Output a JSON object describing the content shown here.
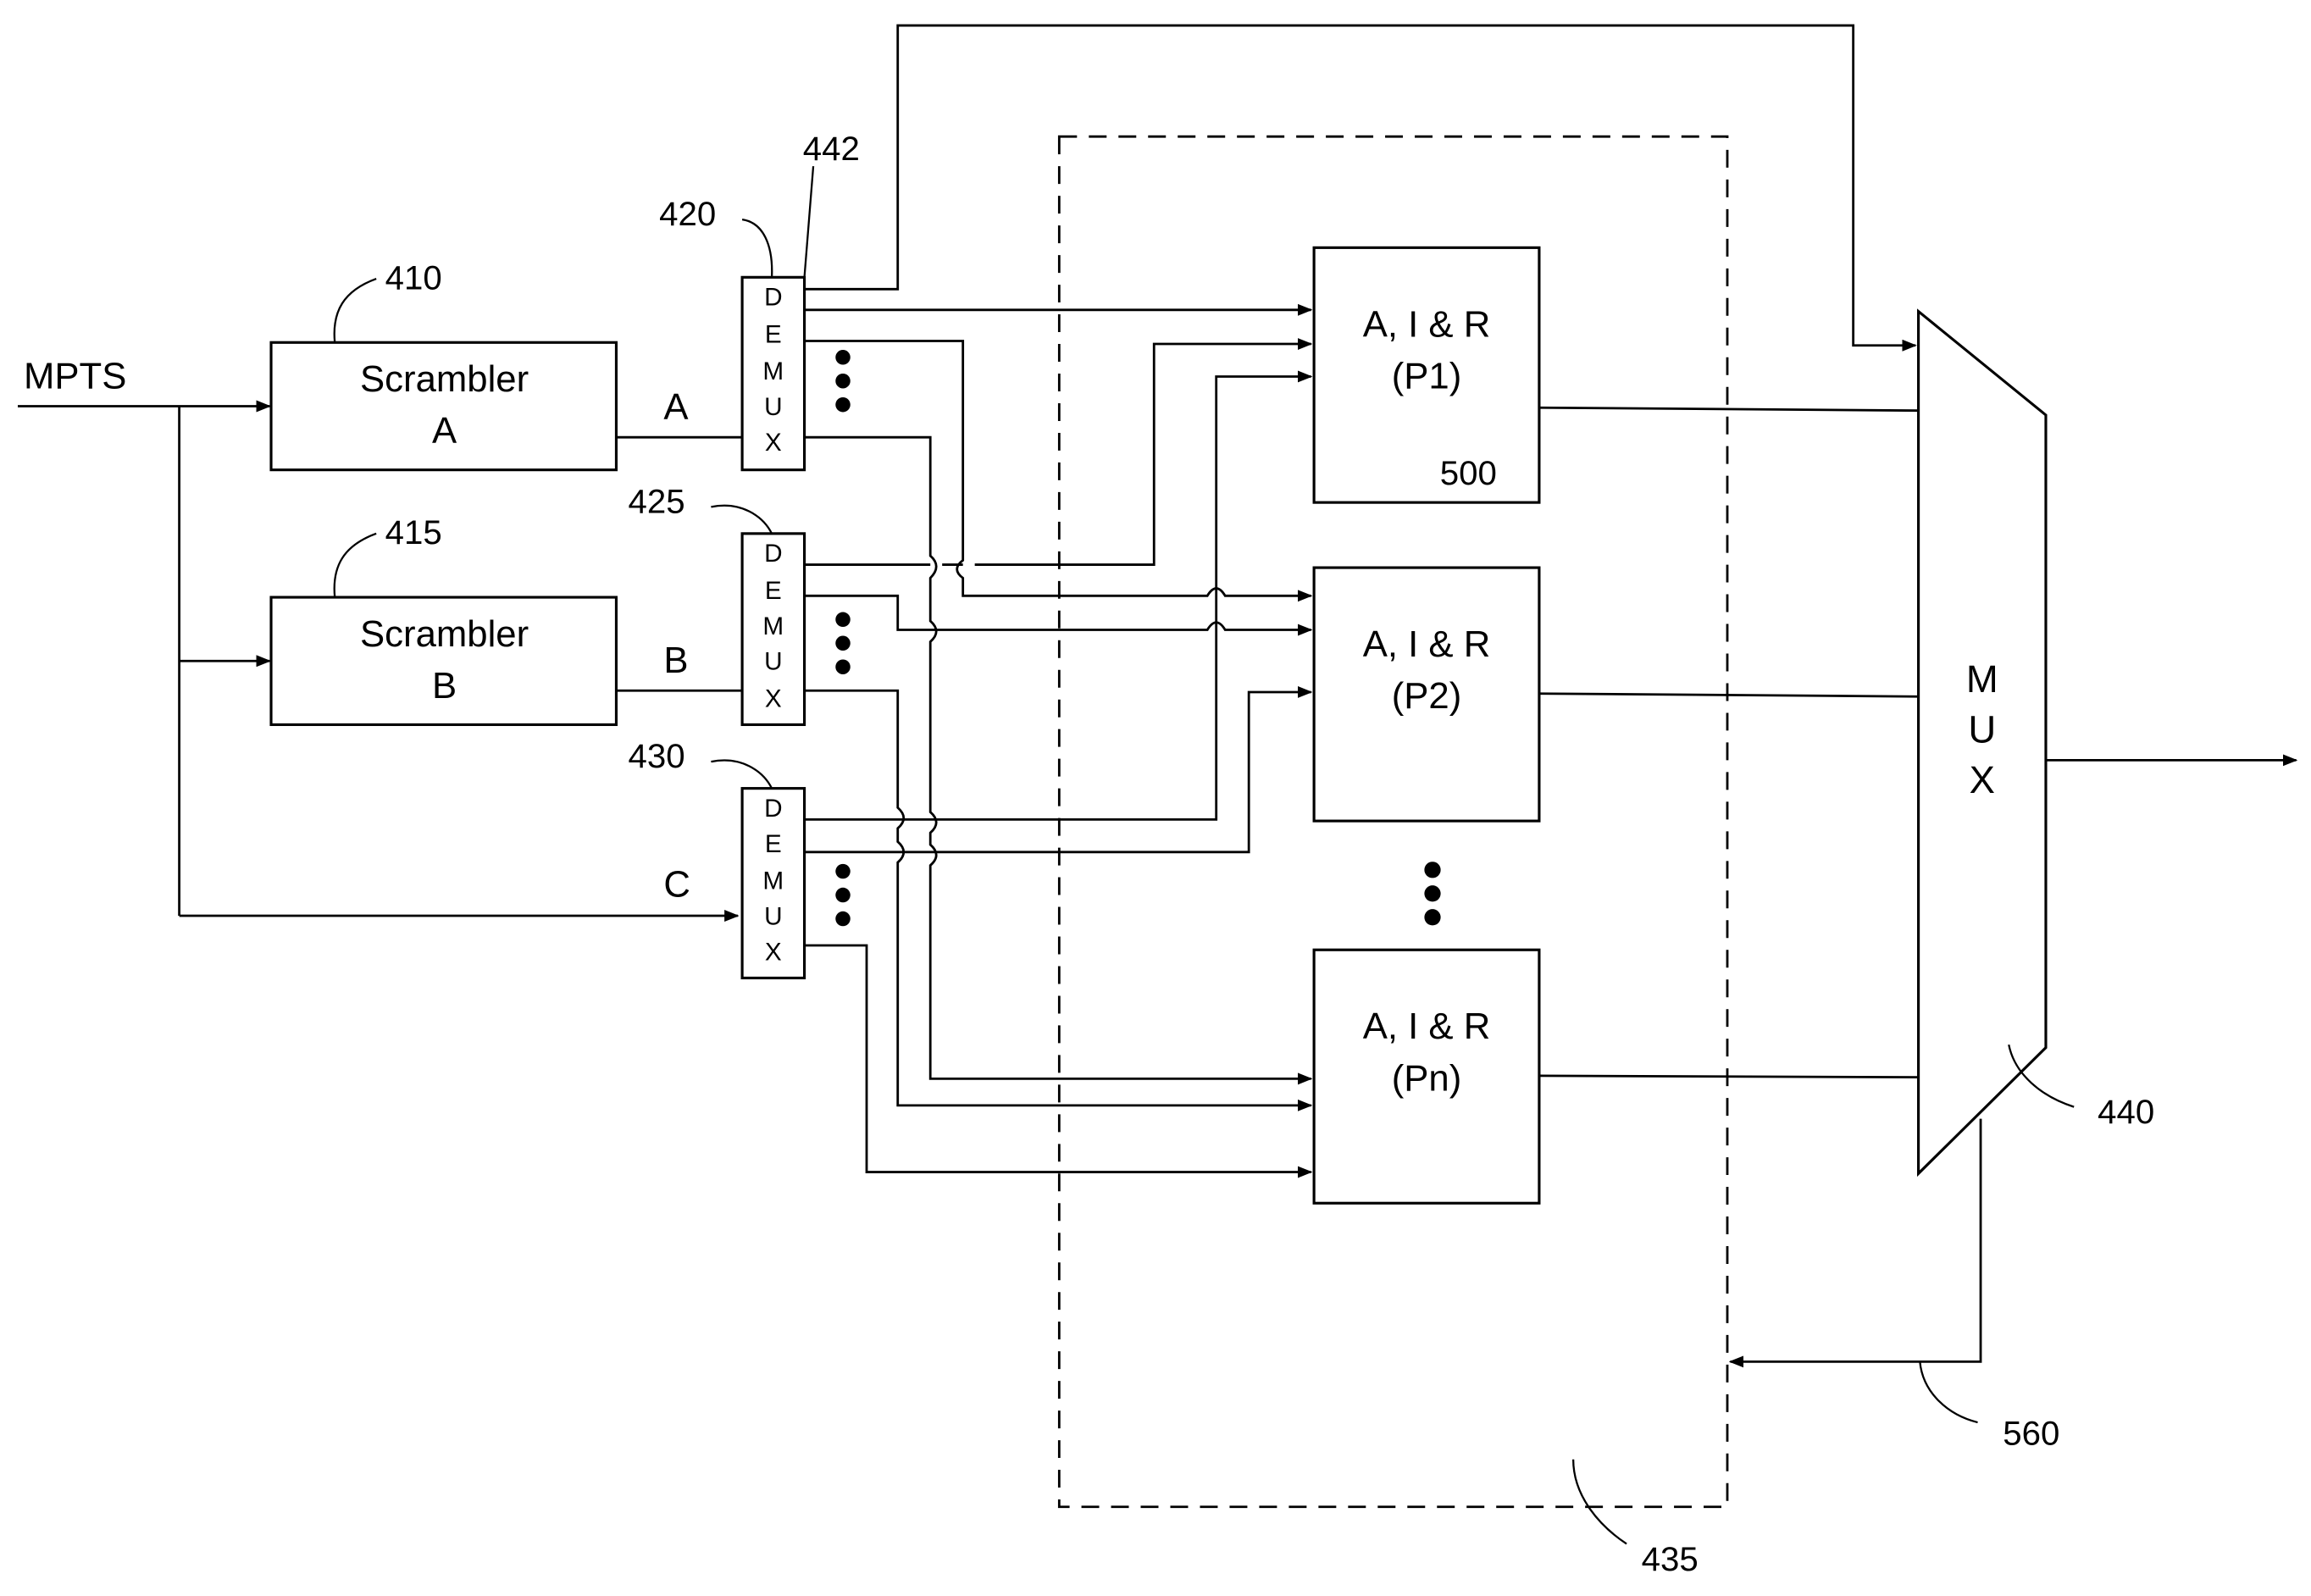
{
  "input_label": "MPTS",
  "scramblers": [
    {
      "ref": "410",
      "line1": "Scrambler",
      "line2": "A",
      "output": "A"
    },
    {
      "ref": "415",
      "line1": "Scrambler",
      "line2": "B",
      "output": "B"
    }
  ],
  "third_path_label": "C",
  "demuxes": [
    {
      "ref": "420",
      "letters": [
        "D",
        "E",
        "M",
        "U",
        "X"
      ]
    },
    {
      "ref": "425",
      "letters": [
        "D",
        "E",
        "M",
        "U",
        "X"
      ]
    },
    {
      "ref": "430",
      "letters": [
        "D",
        "E",
        "M",
        "U",
        "X"
      ]
    }
  ],
  "bypass_ref": "442",
  "processors": [
    {
      "line1": "A, I & R",
      "line2": "(P1)",
      "ref": "500"
    },
    {
      "line1": "A, I & R",
      "line2": "(P2)"
    },
    {
      "line1": "A, I & R",
      "line2": "(Pn)"
    }
  ],
  "processor_group_ref": "435",
  "mux": {
    "letters": [
      "M",
      "U",
      "X"
    ],
    "ref": "440"
  },
  "feedback_ref": "560"
}
